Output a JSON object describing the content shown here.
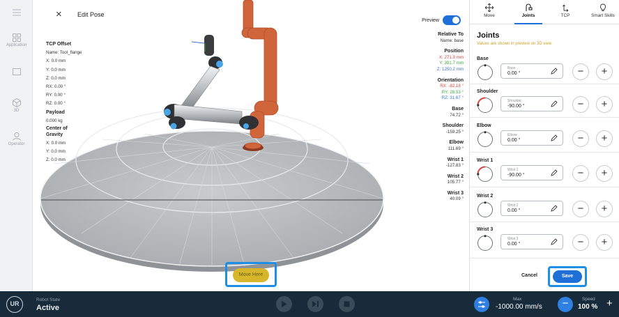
{
  "nav": {
    "items": [
      {
        "label": "",
        "icon": "menu-icon"
      },
      {
        "label": "Application",
        "icon": "grid-icon"
      },
      {
        "label": "",
        "icon": "window-icon"
      },
      {
        "label": "3D",
        "icon": "cube-icon"
      },
      {
        "label": "Operator",
        "icon": "person-icon"
      }
    ]
  },
  "header": {
    "close_icon": "×",
    "title": "Edit Pose"
  },
  "preview": {
    "label": "Preview",
    "enabled": true
  },
  "tcp": {
    "offset_title": "TCP Offset",
    "name": "Name: Tool_flange",
    "x": "X: 0.0 mm",
    "y": "Y: 0.0 mm",
    "z": "Z: 0.0 mm",
    "rx": "RX: 0.00 °",
    "ry": "RY: 0.00 °",
    "rz": "RZ: 0.00 °",
    "payload_title": "Payload",
    "payload": "0.000 kg",
    "cog_title_1": "Center of",
    "cog_title_2": "Gravity",
    "cog_x": "X: 0.0 mm",
    "cog_y": "Y: 0.0 mm",
    "cog_z": "Z: 0.0 mm"
  },
  "readout": {
    "relative_title": "Relative To",
    "relative_name": "Name: base",
    "position_title": "Position",
    "pos_x": "X: 271.9 mm",
    "pos_y": "Y: 391.7 mm",
    "pos_z": "Z: 1250.2 mm",
    "orientation_title": "Orientation",
    "rx": "RX: -82.18 °",
    "ry": "RY: 28.53 °",
    "rz": "RZ: 31.67 °",
    "joints": [
      {
        "name": "Base",
        "value": "74.72 °"
      },
      {
        "name": "Shoulder",
        "value": "-159.25 °"
      },
      {
        "name": "Elbow",
        "value": "111.69 °"
      },
      {
        "name": "Wrist 1",
        "value": "-127.83 °"
      },
      {
        "name": "Wrist 2",
        "value": "105.77 °"
      },
      {
        "name": "Wrist 3",
        "value": "40.09 °"
      }
    ]
  },
  "move_here": "Move Here",
  "panel": {
    "tabs": [
      {
        "label": "Move",
        "icon": "move-arrows-icon"
      },
      {
        "label": "Joints",
        "icon": "joint-icon",
        "active": true
      },
      {
        "label": "TCP",
        "icon": "tcp-icon"
      },
      {
        "label": "Smart Skills",
        "icon": "bulb-icon"
      }
    ],
    "title": "Joints",
    "note": "Values are shown in preview on 3D view",
    "joints": [
      {
        "label": "Base",
        "field_label": "Base",
        "value": "0.00 °",
        "dial": 0.0
      },
      {
        "label": "Shoulder",
        "field_label": "Shoulder",
        "value": "-90.00 °",
        "dial": -0.25
      },
      {
        "label": "Elbow",
        "field_label": "Elbow",
        "value": "0.00 °",
        "dial": 0.0
      },
      {
        "label": "Wrist 1",
        "field_label": "Wrist 1",
        "value": "-90.00 °",
        "dial": -0.25
      },
      {
        "label": "Wrist 2",
        "field_label": "Wrist 2",
        "value": "0.00 °",
        "dial": 0.0
      },
      {
        "label": "Wrist 3",
        "field_label": "Wrist 3",
        "value": "0.00 °",
        "dial": 0.0
      }
    ],
    "cancel": "Cancel",
    "save": "Save"
  },
  "bottom": {
    "logo": "UR",
    "robot_state_label": "Robot State",
    "robot_state": "Active",
    "max_label": "Max",
    "max_value": "-1000.00 mm/s",
    "speed_label": "Speed",
    "speed_value": "100 %"
  },
  "colors": {
    "accent": "#1e6fd8",
    "highlight": "#1f8fe6",
    "robot_preview": "#d0643a",
    "bottom_bar": "#172b3a"
  }
}
